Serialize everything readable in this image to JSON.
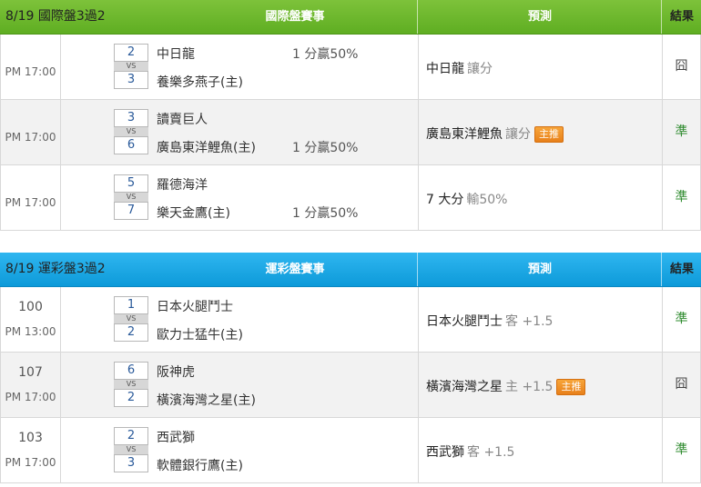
{
  "sections": [
    {
      "title": "8/19 國際盤3過2",
      "header_game": "國際盤賽事",
      "header_pred": "預測",
      "header_result": "結果",
      "rows": [
        {
          "num": "",
          "time": "PM 17:00",
          "score_away": "2",
          "vs": "VS",
          "score_home": "3",
          "team_away": "中日龍",
          "team_home": "養樂多燕子(主)",
          "handicap_away": "1 分贏50%",
          "handicap_home": "",
          "pred_team": "中日龍",
          "pred_type": "讓分",
          "badge": "",
          "result": "囧"
        },
        {
          "num": "",
          "time": "PM 17:00",
          "score_away": "3",
          "vs": "VS",
          "score_home": "6",
          "team_away": "讀賣巨人",
          "team_home": "廣島東洋鯉魚(主)",
          "handicap_away": "",
          "handicap_home": "1 分贏50%",
          "pred_team": "廣島東洋鯉魚",
          "pred_type": "讓分",
          "badge": "主推",
          "result": "準"
        },
        {
          "num": "",
          "time": "PM 17:00",
          "score_away": "5",
          "vs": "VS",
          "score_home": "7",
          "team_away": "羅德海洋",
          "team_home": "樂天金鷹(主)",
          "handicap_away": "",
          "handicap_home": "1 分贏50%",
          "pred_team": "7 大分",
          "pred_type": "輸50%",
          "badge": "",
          "result": "準"
        }
      ]
    },
    {
      "title": "8/19 運彩盤3過2",
      "header_game": "運彩盤賽事",
      "header_pred": "預測",
      "header_result": "結果",
      "rows": [
        {
          "num": "100",
          "time": "PM 13:00",
          "score_away": "1",
          "vs": "VS",
          "score_home": "2",
          "team_away": "日本火腿鬥士",
          "team_home": "歐力士猛牛(主)",
          "handicap_away": "",
          "handicap_home": "",
          "pred_team": "日本火腿鬥士",
          "pred_type": "客 +1.5",
          "badge": "",
          "result": "準"
        },
        {
          "num": "107",
          "time": "PM 17:00",
          "score_away": "6",
          "vs": "VS",
          "score_home": "2",
          "team_away": "阪神虎",
          "team_home": "橫濱海灣之星(主)",
          "handicap_away": "",
          "handicap_home": "",
          "pred_team": "橫濱海灣之星",
          "pred_type": "主 +1.5",
          "badge": "主推",
          "result": "囧"
        },
        {
          "num": "103",
          "time": "PM 17:00",
          "score_away": "2",
          "vs": "VS",
          "score_home": "3",
          "team_away": "西武獅",
          "team_home": "軟體銀行鷹(主)",
          "handicap_away": "",
          "handicap_home": "",
          "pred_team": "西武獅",
          "pred_type": "客 +1.5",
          "badge": "",
          "result": "準"
        }
      ]
    }
  ]
}
